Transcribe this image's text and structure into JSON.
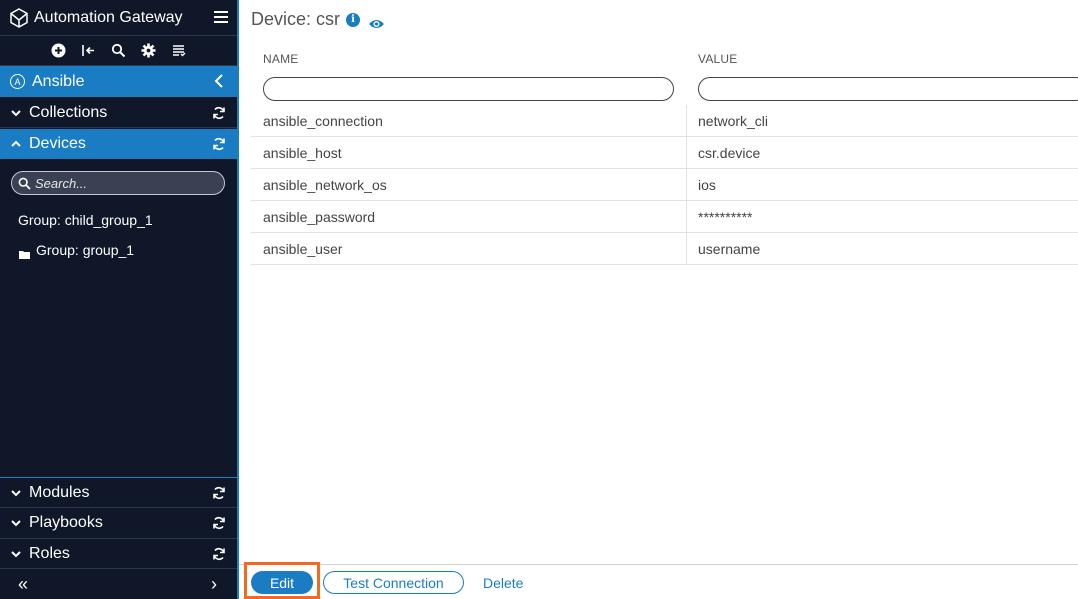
{
  "app": {
    "title": "Automation Gateway"
  },
  "toolbar": {
    "icons": [
      "add-icon",
      "logout-icon",
      "search-icon",
      "gear-icon",
      "list-icon"
    ]
  },
  "sidebar": {
    "section": "Ansible",
    "collections": "Collections",
    "devices": "Devices",
    "search_placeholder": "Search...",
    "tree": [
      "Group: child_group_1",
      "Group: group_1"
    ],
    "modules": "Modules",
    "playbooks": "Playbooks",
    "roles": "Roles",
    "collapse_left": "«",
    "collapse_right": "›"
  },
  "main": {
    "title": "Device: csr",
    "columns": {
      "name": "NAME",
      "value": "VALUE"
    },
    "rows": [
      {
        "name": "ansible_connection",
        "value": "network_cli"
      },
      {
        "name": "ansible_host",
        "value": "csr.device"
      },
      {
        "name": "ansible_network_os",
        "value": "ios"
      },
      {
        "name": "ansible_password",
        "value": "**********"
      },
      {
        "name": "ansible_user",
        "value": "username"
      }
    ]
  },
  "actions": {
    "edit": "Edit",
    "test": "Test Connection",
    "delete": "Delete"
  },
  "colors": {
    "accent": "#1a7dc4",
    "sidebar_bg": "#0f1729",
    "highlight": "#f26a1f"
  }
}
